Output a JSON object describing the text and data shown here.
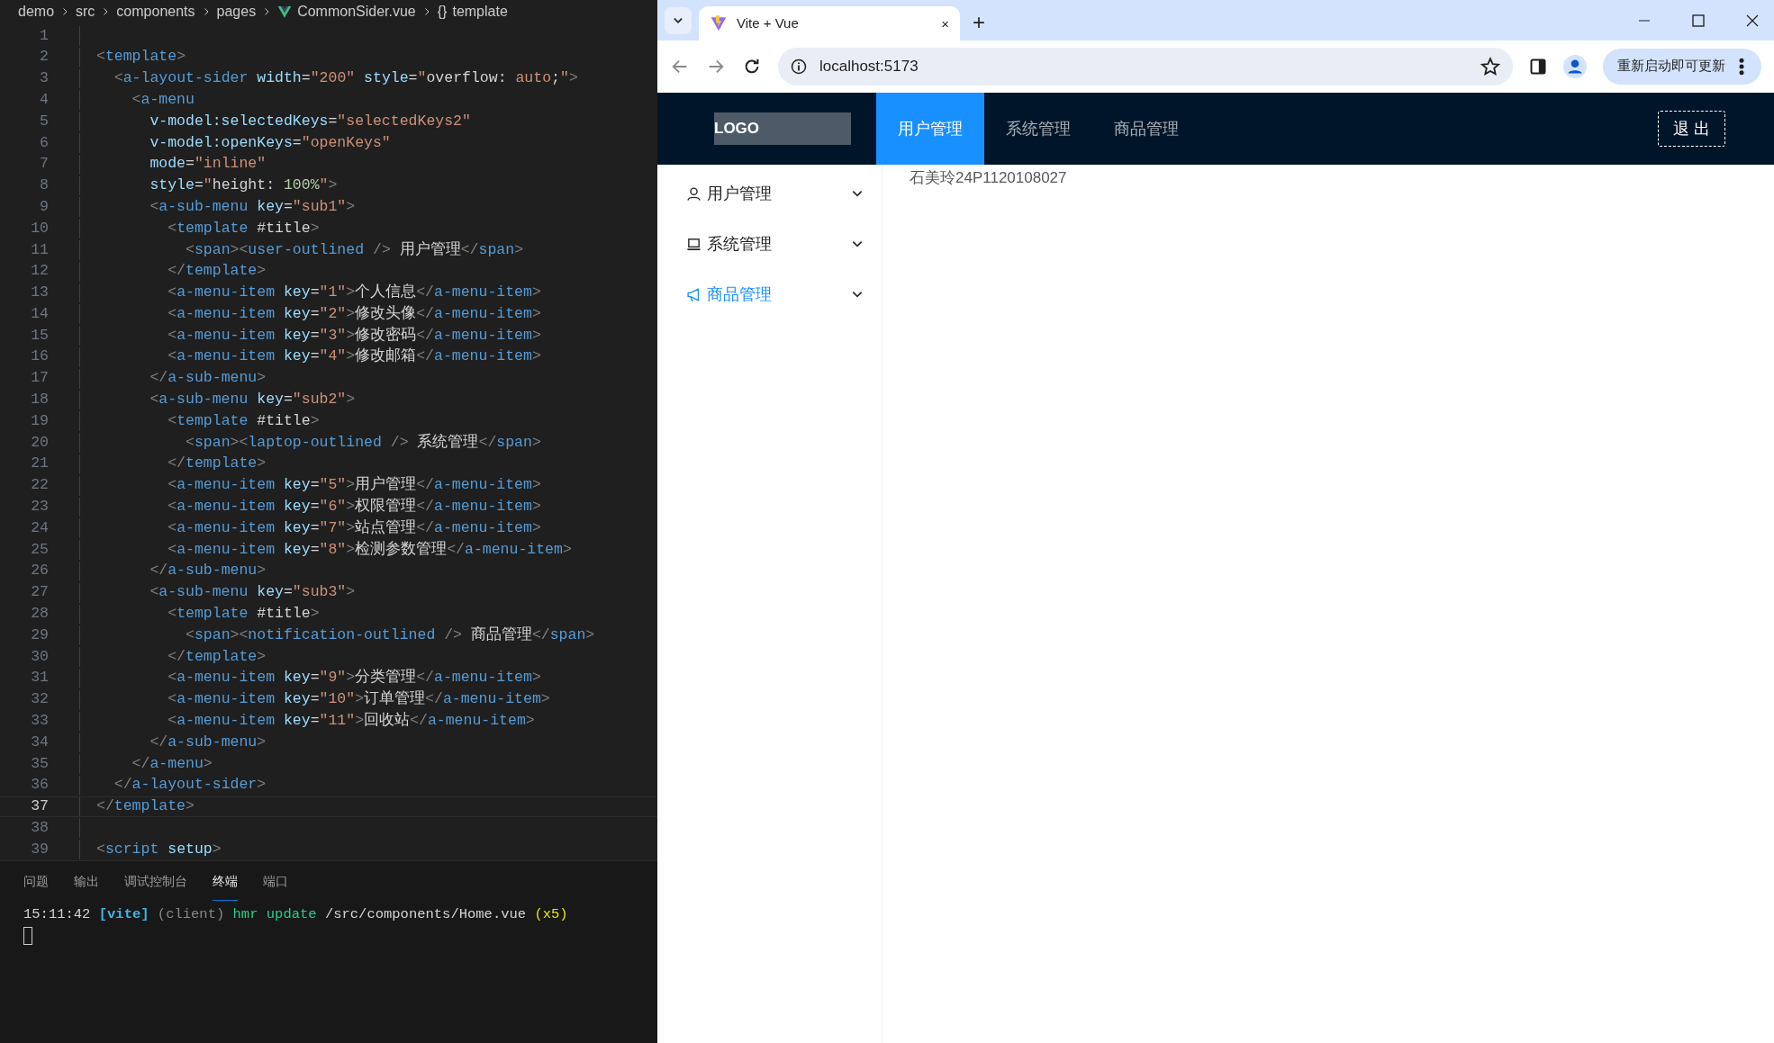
{
  "editor": {
    "breadcrumb": [
      {
        "label": "demo",
        "kind": "folder"
      },
      {
        "label": "src",
        "kind": "folder"
      },
      {
        "label": "components",
        "kind": "folder"
      },
      {
        "label": "pages",
        "kind": "folder"
      },
      {
        "label": "CommonSider.vue",
        "kind": "vue-file"
      },
      {
        "label": "template",
        "kind": "symbol",
        "icon": "{}"
      }
    ],
    "lines": [
      {
        "number": "1",
        "selected": false
      },
      {
        "number": "2",
        "selected": false,
        "tokens": [
          {
            "kind": "punct",
            "text": "<"
          },
          {
            "kind": "tag",
            "text": "template"
          },
          {
            "kind": "punct",
            "text": ">"
          }
        ]
      },
      {
        "number": "3",
        "selected": false,
        "tokens": [
          {
            "kind": "punct",
            "text": "  <"
          },
          {
            "kind": "tag",
            "text": "a-layout-sider"
          },
          {
            "kind": "attr",
            "text": " width"
          },
          {
            "kind": "text",
            "text": "="
          },
          {
            "kind": "string",
            "text": "\"200\""
          },
          {
            "kind": "attr",
            "text": " style"
          },
          {
            "kind": "text",
            "text": "="
          },
          {
            "kind": "string",
            "text": "\""
          },
          {
            "kind": "text",
            "text": "overflow: "
          },
          {
            "kind": "string",
            "text": "auto"
          },
          {
            "kind": "text",
            "text": ";"
          },
          {
            "kind": "string",
            "text": "\""
          },
          {
            "kind": "punct",
            "text": ">"
          }
        ]
      },
      {
        "number": "4",
        "selected": false,
        "tokens": [
          {
            "kind": "punct",
            "text": "    <"
          },
          {
            "kind": "tag",
            "text": "a-menu"
          }
        ]
      },
      {
        "number": "5",
        "selected": false,
        "tokens": [
          {
            "kind": "attr",
            "text": "      v-model:selectedKeys"
          },
          {
            "kind": "text",
            "text": "="
          },
          {
            "kind": "string",
            "text": "\"selectedKeys2\""
          }
        ]
      },
      {
        "number": "6",
        "selected": false,
        "tokens": [
          {
            "kind": "attr",
            "text": "      v-model:openKeys"
          },
          {
            "kind": "text",
            "text": "="
          },
          {
            "kind": "string",
            "text": "\"openKeys\""
          }
        ]
      },
      {
        "number": "7",
        "selected": false,
        "tokens": [
          {
            "kind": "attr",
            "text": "      mode"
          },
          {
            "kind": "text",
            "text": "="
          },
          {
            "kind": "string",
            "text": "\"inline\""
          }
        ]
      },
      {
        "number": "8",
        "selected": false,
        "tokens": [
          {
            "kind": "attr",
            "text": "      style"
          },
          {
            "kind": "text",
            "text": "="
          },
          {
            "kind": "string",
            "text": "\""
          },
          {
            "kind": "text",
            "text": "height: "
          },
          {
            "kind": "number",
            "text": "100%"
          },
          {
            "kind": "string",
            "text": "\""
          },
          {
            "kind": "punct",
            "text": ">"
          }
        ]
      },
      {
        "number": "9",
        "selected": false,
        "tokens": [
          {
            "kind": "punct",
            "text": "      <"
          },
          {
            "kind": "tag",
            "text": "a-sub-menu"
          },
          {
            "kind": "attr",
            "text": " key"
          },
          {
            "kind": "text",
            "text": "="
          },
          {
            "kind": "string",
            "text": "\"sub1\""
          },
          {
            "kind": "punct",
            "text": ">"
          }
        ]
      },
      {
        "number": "10",
        "selected": false,
        "tokens": [
          {
            "kind": "punct",
            "text": "        <"
          },
          {
            "kind": "tag",
            "text": "template"
          },
          {
            "kind": "text",
            "text": " #title"
          },
          {
            "kind": "punct",
            "text": ">"
          }
        ]
      },
      {
        "number": "11",
        "selected": false,
        "tokens": [
          {
            "kind": "punct",
            "text": "          <"
          },
          {
            "kind": "tag",
            "text": "span"
          },
          {
            "kind": "punct",
            "text": "><"
          },
          {
            "kind": "tag",
            "text": "user-outlined"
          },
          {
            "kind": "punct",
            "text": " />"
          },
          {
            "kind": "text",
            "text": " 用户管理"
          },
          {
            "kind": "punct",
            "text": "</"
          },
          {
            "kind": "tag",
            "text": "span"
          },
          {
            "kind": "punct",
            "text": ">"
          }
        ]
      },
      {
        "number": "12",
        "selected": false,
        "tokens": [
          {
            "kind": "punct",
            "text": "        </"
          },
          {
            "kind": "tag",
            "text": "template"
          },
          {
            "kind": "punct",
            "text": ">"
          }
        ]
      },
      {
        "number": "13",
        "selected": false,
        "tokens": [
          {
            "kind": "punct",
            "text": "        <"
          },
          {
            "kind": "tag",
            "text": "a-menu-item"
          },
          {
            "kind": "attr",
            "text": " key"
          },
          {
            "kind": "text",
            "text": "="
          },
          {
            "kind": "string",
            "text": "\"1\""
          },
          {
            "kind": "punct",
            "text": ">"
          },
          {
            "kind": "text",
            "text": "个人信息"
          },
          {
            "kind": "punct",
            "text": "</"
          },
          {
            "kind": "tag",
            "text": "a-menu-item"
          },
          {
            "kind": "punct",
            "text": ">"
          }
        ]
      },
      {
        "number": "14",
        "selected": false,
        "tokens": [
          {
            "kind": "punct",
            "text": "        <"
          },
          {
            "kind": "tag",
            "text": "a-menu-item"
          },
          {
            "kind": "attr",
            "text": " key"
          },
          {
            "kind": "text",
            "text": "="
          },
          {
            "kind": "string",
            "text": "\"2\""
          },
          {
            "kind": "punct",
            "text": ">"
          },
          {
            "kind": "text",
            "text": "修改头像"
          },
          {
            "kind": "punct",
            "text": "</"
          },
          {
            "kind": "tag",
            "text": "a-menu-item"
          },
          {
            "kind": "punct",
            "text": ">"
          }
        ]
      },
      {
        "number": "15",
        "selected": false,
        "tokens": [
          {
            "kind": "punct",
            "text": "        <"
          },
          {
            "kind": "tag",
            "text": "a-menu-item"
          },
          {
            "kind": "attr",
            "text": " key"
          },
          {
            "kind": "text",
            "text": "="
          },
          {
            "kind": "string",
            "text": "\"3\""
          },
          {
            "kind": "punct",
            "text": ">"
          },
          {
            "kind": "text",
            "text": "修改密码"
          },
          {
            "kind": "punct",
            "text": "</"
          },
          {
            "kind": "tag",
            "text": "a-menu-item"
          },
          {
            "kind": "punct",
            "text": ">"
          }
        ]
      },
      {
        "number": "16",
        "selected": false,
        "tokens": [
          {
            "kind": "punct",
            "text": "        <"
          },
          {
            "kind": "tag",
            "text": "a-menu-item"
          },
          {
            "kind": "attr",
            "text": " key"
          },
          {
            "kind": "text",
            "text": "="
          },
          {
            "kind": "string",
            "text": "\"4\""
          },
          {
            "kind": "punct",
            "text": ">"
          },
          {
            "kind": "text",
            "text": "修改邮箱"
          },
          {
            "kind": "punct",
            "text": "</"
          },
          {
            "kind": "tag",
            "text": "a-menu-item"
          },
          {
            "kind": "punct",
            "text": ">"
          }
        ]
      },
      {
        "number": "17",
        "selected": false,
        "tokens": [
          {
            "kind": "punct",
            "text": "      </"
          },
          {
            "kind": "tag",
            "text": "a-sub-menu"
          },
          {
            "kind": "punct",
            "text": ">"
          }
        ]
      },
      {
        "number": "18",
        "selected": false,
        "tokens": [
          {
            "kind": "punct",
            "text": "      <"
          },
          {
            "kind": "tag",
            "text": "a-sub-menu"
          },
          {
            "kind": "attr",
            "text": " key"
          },
          {
            "kind": "text",
            "text": "="
          },
          {
            "kind": "string",
            "text": "\"sub2\""
          },
          {
            "kind": "punct",
            "text": ">"
          }
        ]
      },
      {
        "number": "19",
        "selected": false,
        "tokens": [
          {
            "kind": "punct",
            "text": "        <"
          },
          {
            "kind": "tag",
            "text": "template"
          },
          {
            "kind": "text",
            "text": " #title"
          },
          {
            "kind": "punct",
            "text": ">"
          }
        ]
      },
      {
        "number": "20",
        "selected": false,
        "tokens": [
          {
            "kind": "punct",
            "text": "          <"
          },
          {
            "kind": "tag",
            "text": "span"
          },
          {
            "kind": "punct",
            "text": "><"
          },
          {
            "kind": "tag",
            "text": "laptop-outlined"
          },
          {
            "kind": "punct",
            "text": " />"
          },
          {
            "kind": "text",
            "text": " 系统管理"
          },
          {
            "kind": "punct",
            "text": "</"
          },
          {
            "kind": "tag",
            "text": "span"
          },
          {
            "kind": "punct",
            "text": ">"
          }
        ]
      },
      {
        "number": "21",
        "selected": false,
        "tokens": [
          {
            "kind": "punct",
            "text": "        </"
          },
          {
            "kind": "tag",
            "text": "template"
          },
          {
            "kind": "punct",
            "text": ">"
          }
        ]
      },
      {
        "number": "22",
        "selected": false,
        "tokens": [
          {
            "kind": "punct",
            "text": "        <"
          },
          {
            "kind": "tag",
            "text": "a-menu-item"
          },
          {
            "kind": "attr",
            "text": " key"
          },
          {
            "kind": "text",
            "text": "="
          },
          {
            "kind": "string",
            "text": "\"5\""
          },
          {
            "kind": "punct",
            "text": ">"
          },
          {
            "kind": "text",
            "text": "用户管理"
          },
          {
            "kind": "punct",
            "text": "</"
          },
          {
            "kind": "tag",
            "text": "a-menu-item"
          },
          {
            "kind": "punct",
            "text": ">"
          }
        ]
      },
      {
        "number": "23",
        "selected": false,
        "tokens": [
          {
            "kind": "punct",
            "text": "        <"
          },
          {
            "kind": "tag",
            "text": "a-menu-item"
          },
          {
            "kind": "attr",
            "text": " key"
          },
          {
            "kind": "text",
            "text": "="
          },
          {
            "kind": "string",
            "text": "\"6\""
          },
          {
            "kind": "punct",
            "text": ">"
          },
          {
            "kind": "text",
            "text": "权限管理"
          },
          {
            "kind": "punct",
            "text": "</"
          },
          {
            "kind": "tag",
            "text": "a-menu-item"
          },
          {
            "kind": "punct",
            "text": ">"
          }
        ]
      },
      {
        "number": "24",
        "selected": false,
        "tokens": [
          {
            "kind": "punct",
            "text": "        <"
          },
          {
            "kind": "tag",
            "text": "a-menu-item"
          },
          {
            "kind": "attr",
            "text": " key"
          },
          {
            "kind": "text",
            "text": "="
          },
          {
            "kind": "string",
            "text": "\"7\""
          },
          {
            "kind": "punct",
            "text": ">"
          },
          {
            "kind": "text",
            "text": "站点管理"
          },
          {
            "kind": "punct",
            "text": "</"
          },
          {
            "kind": "tag",
            "text": "a-menu-item"
          },
          {
            "kind": "punct",
            "text": ">"
          }
        ]
      },
      {
        "number": "25",
        "selected": false,
        "tokens": [
          {
            "kind": "punct",
            "text": "        <"
          },
          {
            "kind": "tag",
            "text": "a-menu-item"
          },
          {
            "kind": "attr",
            "text": " key"
          },
          {
            "kind": "text",
            "text": "="
          },
          {
            "kind": "string",
            "text": "\"8\""
          },
          {
            "kind": "punct",
            "text": ">"
          },
          {
            "kind": "text",
            "text": "检测参数管理"
          },
          {
            "kind": "punct",
            "text": "</"
          },
          {
            "kind": "tag",
            "text": "a-menu-item"
          },
          {
            "kind": "punct",
            "text": ">"
          }
        ]
      },
      {
        "number": "26",
        "selected": false,
        "tokens": [
          {
            "kind": "punct",
            "text": "      </"
          },
          {
            "kind": "tag",
            "text": "a-sub-menu"
          },
          {
            "kind": "punct",
            "text": ">"
          }
        ]
      },
      {
        "number": "27",
        "selected": false,
        "tokens": [
          {
            "kind": "punct",
            "text": "      <"
          },
          {
            "kind": "tag",
            "text": "a-sub-menu"
          },
          {
            "kind": "attr",
            "text": " key"
          },
          {
            "kind": "text",
            "text": "="
          },
          {
            "kind": "string",
            "text": "\"sub3\""
          },
          {
            "kind": "punct",
            "text": ">"
          }
        ]
      },
      {
        "number": "28",
        "selected": false,
        "tokens": [
          {
            "kind": "punct",
            "text": "        <"
          },
          {
            "kind": "tag",
            "text": "template"
          },
          {
            "kind": "text",
            "text": " #title"
          },
          {
            "kind": "punct",
            "text": ">"
          }
        ]
      },
      {
        "number": "29",
        "selected": false,
        "tokens": [
          {
            "kind": "punct",
            "text": "          <"
          },
          {
            "kind": "tag",
            "text": "span"
          },
          {
            "kind": "punct",
            "text": "><"
          },
          {
            "kind": "tag",
            "text": "notification-outlined"
          },
          {
            "kind": "punct",
            "text": " />"
          },
          {
            "kind": "text",
            "text": " 商品管理"
          },
          {
            "kind": "punct",
            "text": "</"
          },
          {
            "kind": "tag",
            "text": "span"
          },
          {
            "kind": "punct",
            "text": ">"
          }
        ]
      },
      {
        "number": "30",
        "selected": false,
        "tokens": [
          {
            "kind": "punct",
            "text": "        </"
          },
          {
            "kind": "tag",
            "text": "template"
          },
          {
            "kind": "punct",
            "text": ">"
          }
        ]
      },
      {
        "number": "31",
        "selected": false,
        "tokens": [
          {
            "kind": "punct",
            "text": "        <"
          },
          {
            "kind": "tag",
            "text": "a-menu-item"
          },
          {
            "kind": "attr",
            "text": " key"
          },
          {
            "kind": "text",
            "text": "="
          },
          {
            "kind": "string",
            "text": "\"9\""
          },
          {
            "kind": "punct",
            "text": ">"
          },
          {
            "kind": "text",
            "text": "分类管理"
          },
          {
            "kind": "punct",
            "text": "</"
          },
          {
            "kind": "tag",
            "text": "a-menu-item"
          },
          {
            "kind": "punct",
            "text": ">"
          }
        ]
      },
      {
        "number": "32",
        "selected": false,
        "tokens": [
          {
            "kind": "punct",
            "text": "        <"
          },
          {
            "kind": "tag",
            "text": "a-menu-item"
          },
          {
            "kind": "attr",
            "text": " key"
          },
          {
            "kind": "text",
            "text": "="
          },
          {
            "kind": "string",
            "text": "\"10\""
          },
          {
            "kind": "punct",
            "text": ">"
          },
          {
            "kind": "text",
            "text": "订单管理"
          },
          {
            "kind": "punct",
            "text": "</"
          },
          {
            "kind": "tag",
            "text": "a-menu-item"
          },
          {
            "kind": "punct",
            "text": ">"
          }
        ]
      },
      {
        "number": "33",
        "selected": false,
        "tokens": [
          {
            "kind": "punct",
            "text": "        <"
          },
          {
            "kind": "tag",
            "text": "a-menu-item"
          },
          {
            "kind": "attr",
            "text": " key"
          },
          {
            "kind": "text",
            "text": "="
          },
          {
            "kind": "string",
            "text": "\"11\""
          },
          {
            "kind": "punct",
            "text": ">"
          },
          {
            "kind": "text",
            "text": "回收站"
          },
          {
            "kind": "punct",
            "text": "</"
          },
          {
            "kind": "tag",
            "text": "a-menu-item"
          },
          {
            "kind": "punct",
            "text": ">"
          }
        ]
      },
      {
        "number": "34",
        "selected": false,
        "tokens": [
          {
            "kind": "punct",
            "text": "      </"
          },
          {
            "kind": "tag",
            "text": "a-sub-menu"
          },
          {
            "kind": "punct",
            "text": ">"
          }
        ]
      },
      {
        "number": "35",
        "selected": false,
        "tokens": [
          {
            "kind": "punct",
            "text": "    </"
          },
          {
            "kind": "tag",
            "text": "a-menu"
          },
          {
            "kind": "punct",
            "text": ">"
          }
        ]
      },
      {
        "number": "36",
        "selected": false,
        "tokens": [
          {
            "kind": "punct",
            "text": "  </"
          },
          {
            "kind": "tag",
            "text": "a-layout-sider"
          },
          {
            "kind": "punct",
            "text": ">"
          }
        ]
      },
      {
        "number": "37",
        "selected": true,
        "tokens": [
          {
            "kind": "punct",
            "text": "</"
          },
          {
            "kind": "tag",
            "text": "template"
          },
          {
            "kind": "punct",
            "text": ">"
          }
        ]
      },
      {
        "number": "38",
        "selected": false
      },
      {
        "number": "39",
        "selected": false,
        "tokens": [
          {
            "kind": "punct",
            "text": "<"
          },
          {
            "kind": "tag",
            "text": "script"
          },
          {
            "kind": "attr",
            "text": " setup"
          },
          {
            "kind": "punct",
            "text": ">"
          }
        ]
      }
    ],
    "panel": {
      "tabs": [
        {
          "label": "问题",
          "selected": false
        },
        {
          "label": "输出",
          "selected": false
        },
        {
          "label": "调试控制台",
          "selected": false
        },
        {
          "label": "终端",
          "selected": true
        },
        {
          "label": "端口",
          "selected": false
        }
      ],
      "terminal": [
        {
          "kind": "text",
          "text": "15:11:42"
        },
        {
          "kind": "vite",
          "text": " [vite]"
        },
        {
          "kind": "muted",
          "text": " (client)"
        },
        {
          "kind": "green",
          "text": " hmr update"
        },
        {
          "kind": "text",
          "text": " /src/components/Home.vue"
        },
        {
          "kind": "yellow",
          "text": " (x5)"
        }
      ]
    }
  },
  "browser": {
    "tab": {
      "title": "Vite + Vue",
      "close": "×"
    },
    "new_tab": "+",
    "address": "localhost:5173",
    "update_button": "重新启动即可更新",
    "app": {
      "logo": "LOGO",
      "nav": [
        {
          "label": "用户管理",
          "selected": true
        },
        {
          "label": "系统管理",
          "selected": false
        },
        {
          "label": "商品管理",
          "selected": false
        }
      ],
      "logout": "退 出",
      "sider": [
        {
          "label": "用户管理",
          "kind": "user",
          "selected": false
        },
        {
          "label": "系统管理",
          "kind": "laptop",
          "selected": false
        },
        {
          "label": "商品管理",
          "kind": "notification",
          "selected": true
        }
      ],
      "content_text": "石美玲24P1120108027"
    }
  }
}
